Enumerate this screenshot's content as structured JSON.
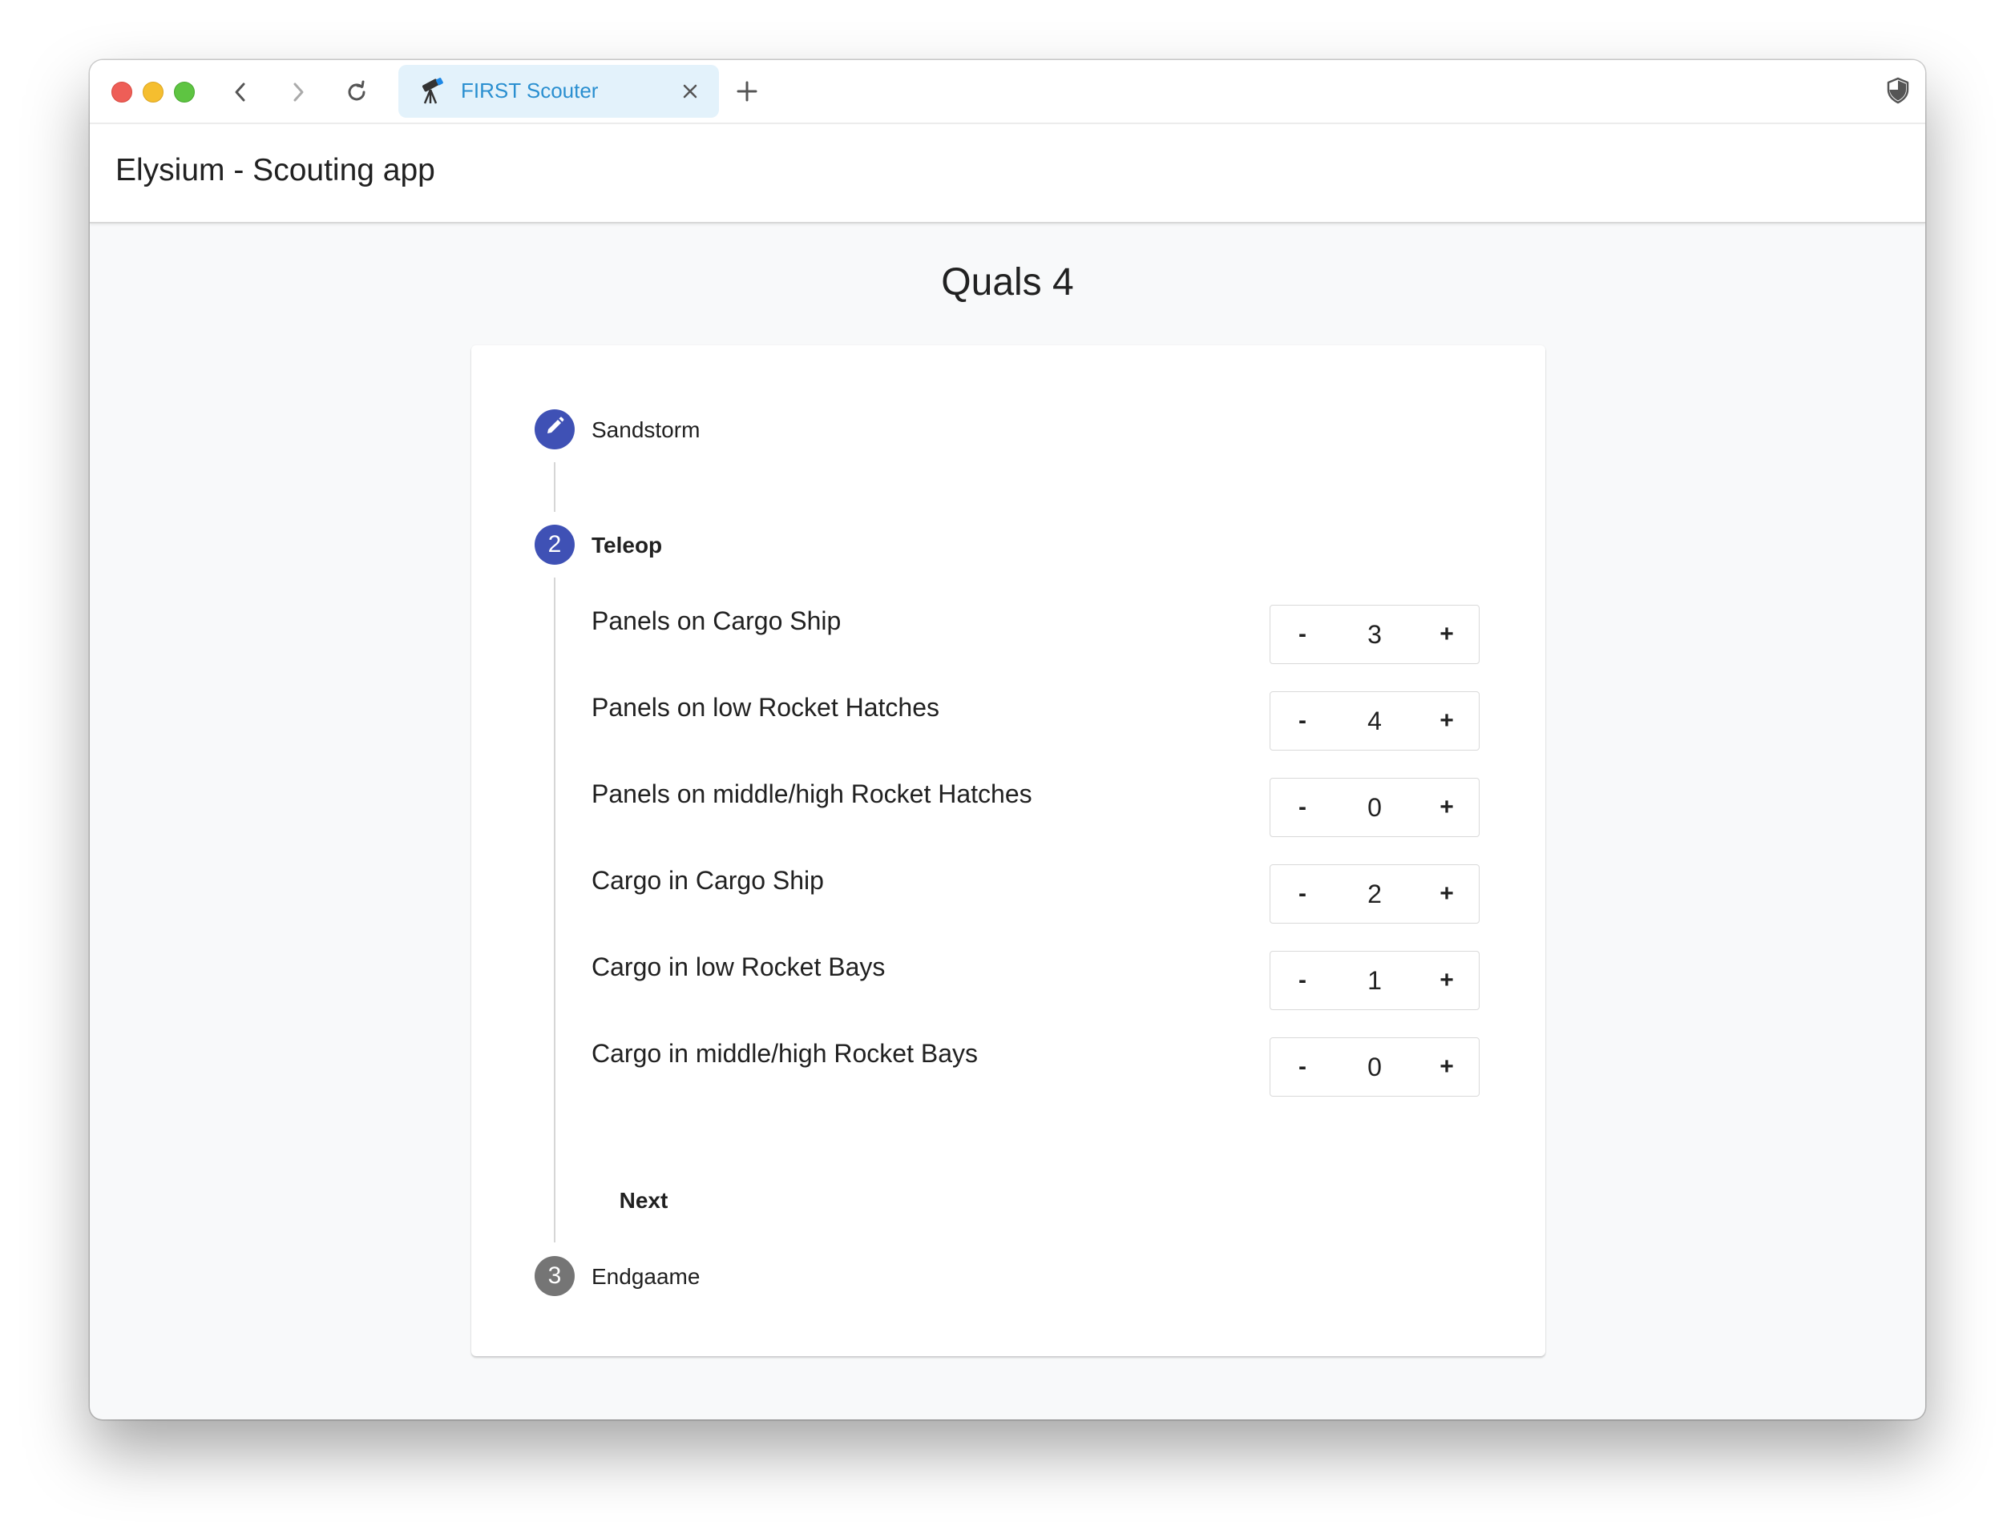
{
  "browser": {
    "tab_title": "FIRST Scouter",
    "tab_icon": "telescope-icon",
    "new_tab_symbol": "+"
  },
  "app": {
    "title": "Elysium - Scouting app"
  },
  "page": {
    "title": "Quals 4"
  },
  "steps": [
    {
      "label": "Sandstorm",
      "icon": "pencil-icon",
      "state": "completed"
    },
    {
      "label": "Teleop",
      "number": "2",
      "state": "active"
    },
    {
      "label": "Endgaame",
      "number": "3",
      "state": "inactive"
    }
  ],
  "teleop": {
    "fields": [
      {
        "label": "Panels on Cargo Ship",
        "value": "3"
      },
      {
        "label": "Panels on low Rocket Hatches",
        "value": "4"
      },
      {
        "label": "Panels on middle/high Rocket Hatches",
        "value": "0"
      },
      {
        "label": "Cargo in Cargo Ship",
        "value": "2"
      },
      {
        "label": "Cargo in low Rocket Bays",
        "value": "1"
      },
      {
        "label": "Cargo in middle/high Rocket Bays",
        "value": "0"
      }
    ],
    "decrement_label": "-",
    "increment_label": "+",
    "next_label": "Next"
  },
  "colors": {
    "accent": "#3f51b5",
    "inactive_step": "#757575",
    "tab_background": "#e3f2fb",
    "tab_text": "#2a8fd0"
  }
}
